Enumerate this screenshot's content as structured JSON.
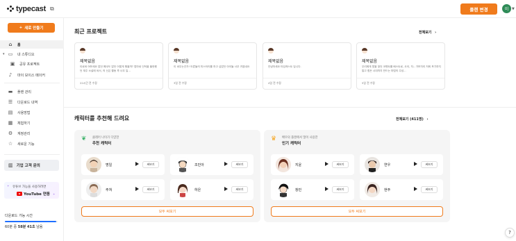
{
  "brand": {
    "name": "typecast"
  },
  "header": {
    "upgrade_label": "플랜 변경",
    "avatar_initial": "이"
  },
  "sidebar": {
    "new_button": "새로 만들기",
    "items": [
      {
        "label": "홈",
        "icon": "home-icon",
        "active": true
      },
      {
        "label": "내 스튜디오",
        "icon": "folder-icon"
      },
      {
        "label": "공유 프로젝트",
        "icon": "shared-folder-icon"
      },
      {
        "label": "마이 보이스 메이커",
        "icon": "voice-maker-icon"
      },
      {
        "label": "플랜 관리",
        "icon": "card-icon"
      },
      {
        "label": "다운로드 내역",
        "icon": "download-list-icon"
      },
      {
        "label": "사용방법",
        "icon": "guide-icon"
      },
      {
        "label": "체험하기",
        "icon": "calendar-icon"
      },
      {
        "label": "계정관리",
        "icon": "gear-icon"
      },
      {
        "label": "새로운 기능",
        "icon": "star-icon"
      }
    ],
    "business_inquiry": "기업 고객 문의",
    "youtube_banner": {
      "line1": "유튜브 가능을 사용하려면",
      "line2": "YouTube 연동"
    },
    "download": {
      "title": "다운로드 가능 시간",
      "remaining_prefix": "60분 중",
      "remaining_value": "58분 41초",
      "remaining_suffix": "남음",
      "progress": 0.978
    },
    "accent": "#f07b1c",
    "progress_color": "#1e6fff"
  },
  "recent": {
    "title": "최근 프로젝트",
    "see_all": "전체보기",
    "projects": [
      {
        "title": "제목없음",
        "desc": "이로써 여보세요 없던 폐쿠도 없던 어떻게 했을까? 엄마네 언덕을 올랐했던 재주 소설에 써서, 의 신은 활동 후 너무 일...",
        "time": "22시간 전 수정"
      },
      {
        "title": "제목없음",
        "desc": "이 싸우는건가! 어른들의 미스터리를 하고 싶었던 아이들 너무 귀엽네요",
        "time": "3일 전 수정"
      },
      {
        "title": "제목없음",
        "desc": "안녕하세요 타입캐스트 입니다.",
        "time": "4일 전 수정"
      },
      {
        "title": "제목없음",
        "desc": "우리에게 맞을 찾던 코멘트를 베스트로, 사이, 자-- 가보자리 저희 포기하지 말고 힘든 시대까지 만드는 마법의 주성...",
        "time": "5일 전 수정"
      }
    ]
  },
  "recommend": {
    "title": "캐릭터를 추천해 드려요",
    "see_all": "전체보기 (411명)",
    "panels": [
      {
        "icon": "leaf-icon",
        "subtitle": "클레어 나이가 다양한",
        "name": "추천 캐릭터",
        "characters": [
          {
            "name": "명일"
          },
          {
            "name": "조민아"
          },
          {
            "name": "주쳐"
          },
          {
            "name": "하은"
          }
        ],
        "more": "모두 써보기"
      },
      {
        "icon": "crown-icon",
        "subtitle": "배우의 플랜에서 많이 사용한",
        "name": "인기 캐릭터",
        "characters": [
          {
            "name": "지윤"
          },
          {
            "name": "연우"
          },
          {
            "name": "창민"
          },
          {
            "name": "현주"
          }
        ],
        "more": "모두 써보기"
      }
    ],
    "preview_label": "써보기"
  },
  "help_label": "?"
}
